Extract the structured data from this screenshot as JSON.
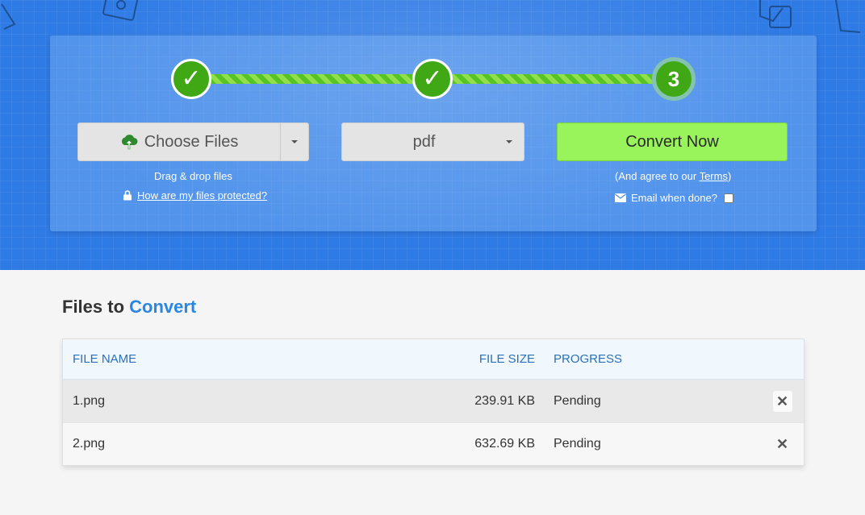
{
  "steps": [
    {
      "label": "✓",
      "state": "done"
    },
    {
      "label": "✓",
      "state": "done"
    },
    {
      "label": "3",
      "state": "active"
    }
  ],
  "choose_files": {
    "label": "Choose Files",
    "icon": "cloud-upload-icon"
  },
  "drag_drop": "Drag & drop files",
  "protected_link": "How are my files protected?",
  "format_select": {
    "value": "pdf"
  },
  "convert_button": "Convert Now",
  "terms": {
    "prefix": "(And agree to our ",
    "link": "Terms",
    "suffix": ")"
  },
  "email_label": "Email when done?",
  "section_title": {
    "part1": "Files to ",
    "part2": "Convert"
  },
  "table": {
    "headers": {
      "name": "FILE NAME",
      "size": "FILE SIZE",
      "progress": "PROGRESS"
    },
    "rows": [
      {
        "name": "1.png",
        "size": "239.91 KB",
        "progress": "Pending"
      },
      {
        "name": "2.png",
        "size": "632.69 KB",
        "progress": "Pending"
      }
    ]
  },
  "colors": {
    "brand_blue": "#2f7be6",
    "step_green": "#3fa814",
    "convert_green": "#99f35a",
    "accent": "#2a86e0"
  }
}
